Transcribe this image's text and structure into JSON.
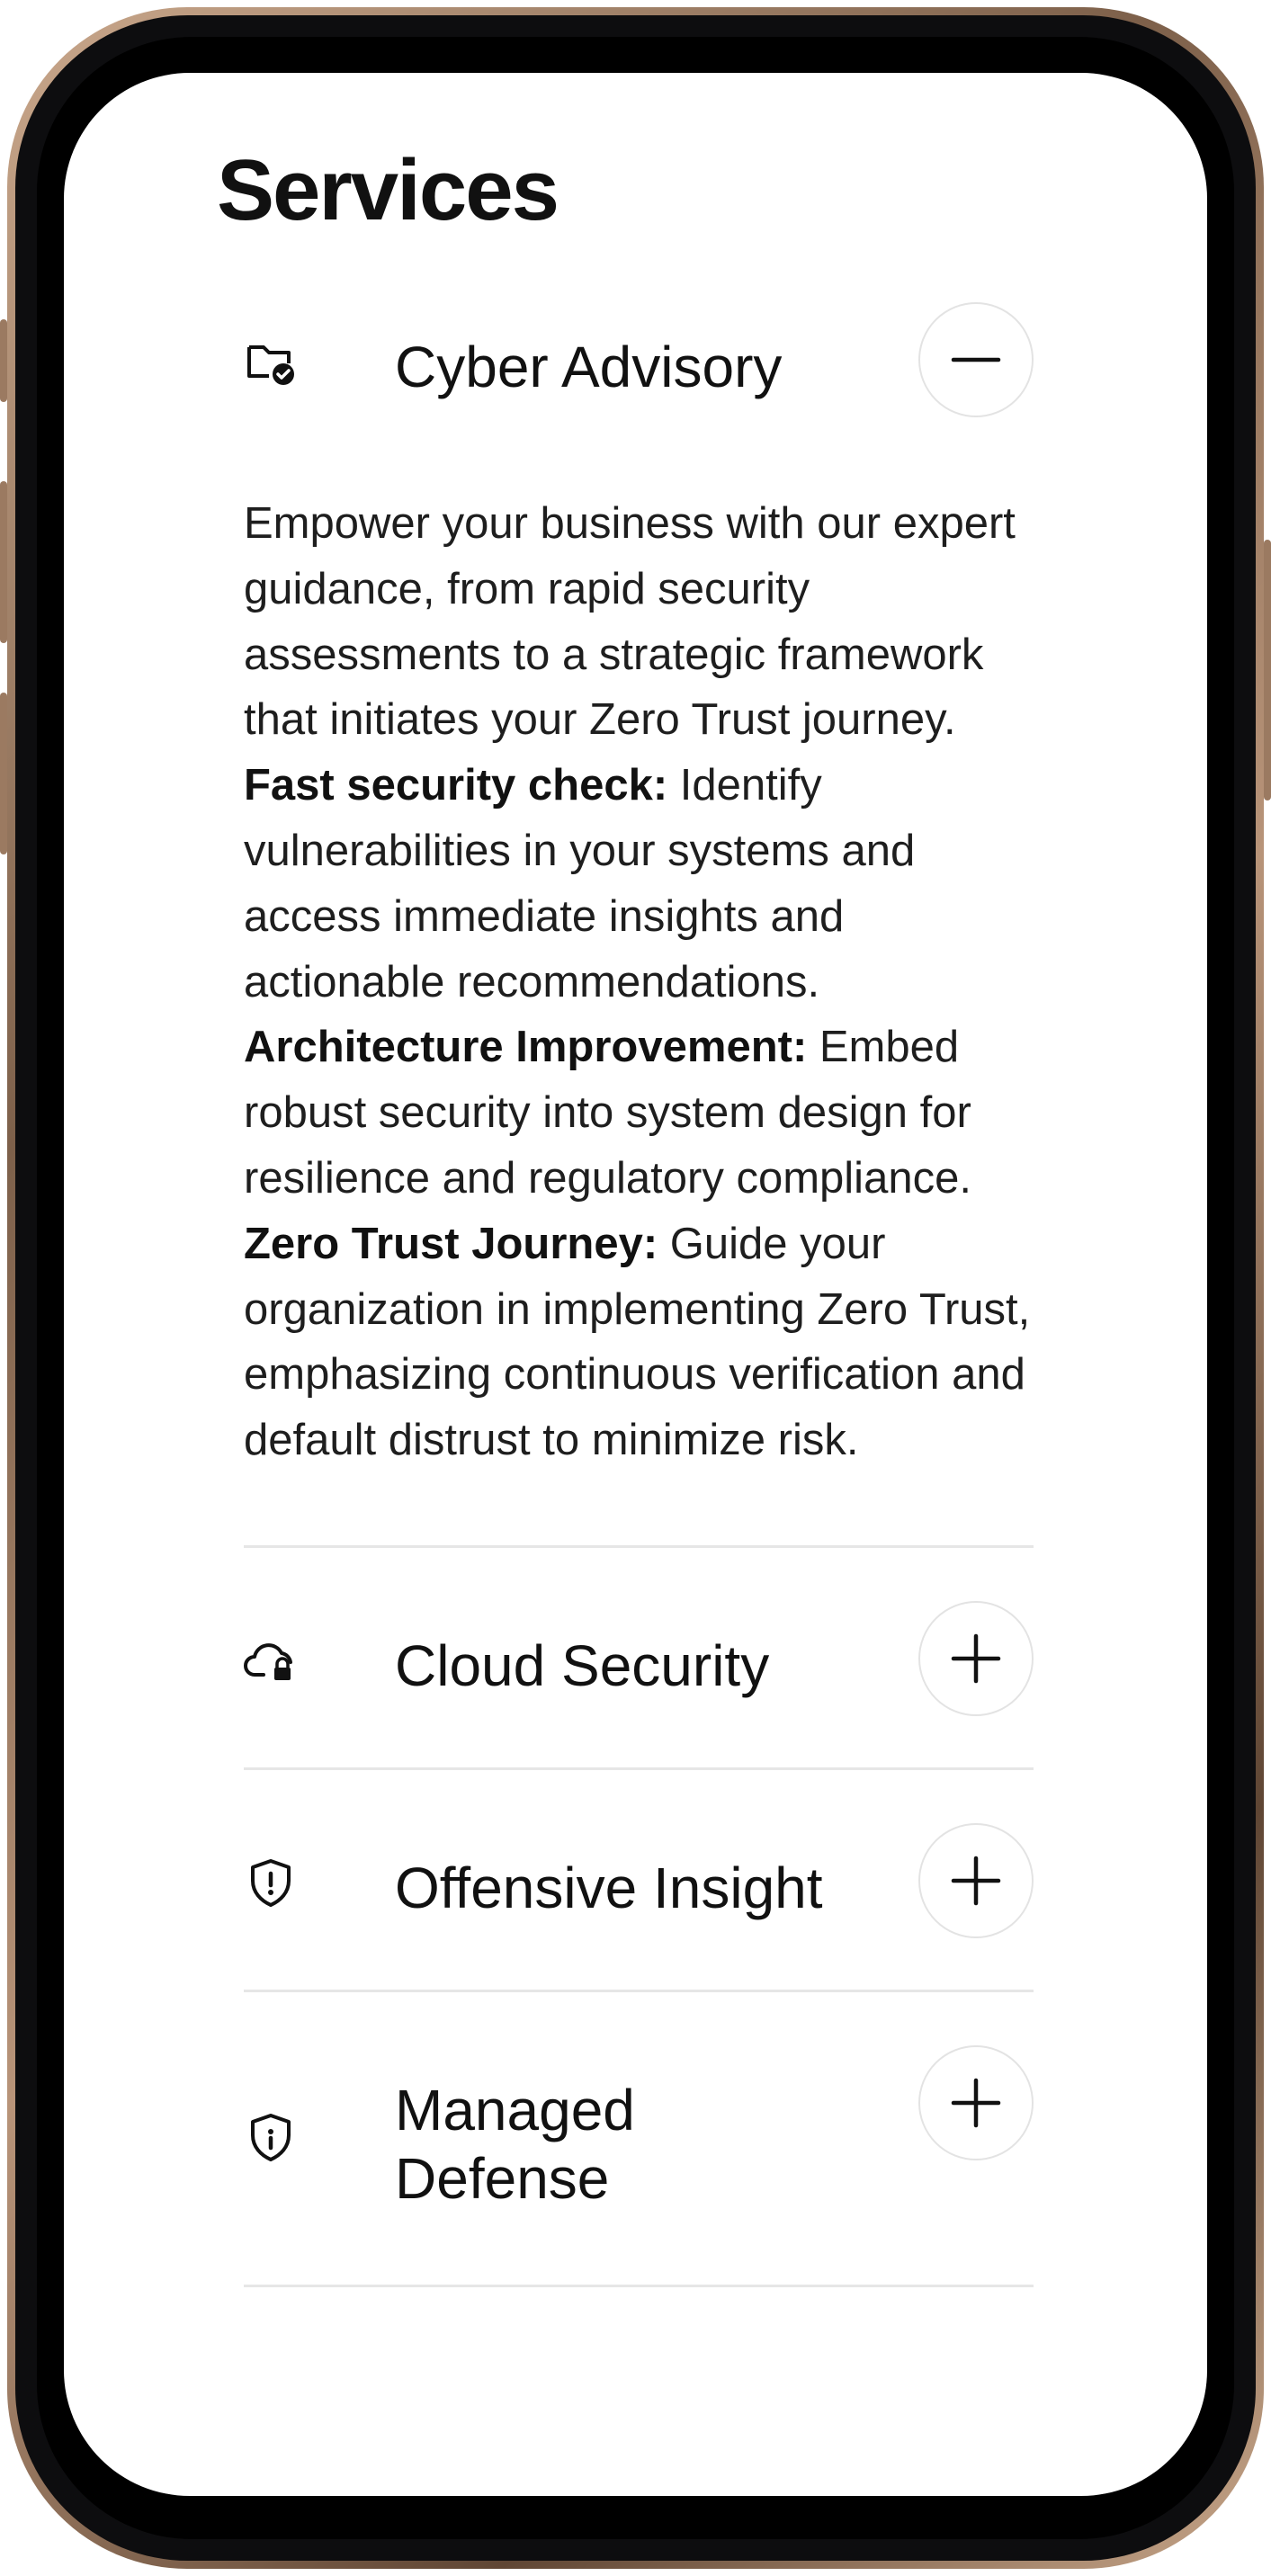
{
  "page": {
    "title": "Services"
  },
  "services": [
    {
      "title": "Cyber Advisory",
      "icon": "folder-check-icon",
      "expanded": true,
      "toggle_icon": "minus-icon",
      "intro": "Empower your business with our expert guidance, from rapid security assessments to a strategic framework that initiates your Zero Trust journey.",
      "points": [
        {
          "label": "Fast security check:",
          "text": " Identify vulnerabilities in your systems and access immediate insights and actionable recommendations."
        },
        {
          "label": "Architecture Improvement:",
          "text": " Embed robust security into system design for resilience and regulatory compliance."
        },
        {
          "label": "Zero Trust Journey:",
          "text": " Guide your organization in implementing Zero Trust, emphasizing continuous verification and default distrust to minimize risk."
        }
      ]
    },
    {
      "title": "Cloud Security",
      "icon": "cloud-lock-icon",
      "expanded": false,
      "toggle_icon": "plus-icon"
    },
    {
      "title": "Offensive Insight",
      "icon": "shield-alert-icon",
      "expanded": false,
      "toggle_icon": "plus-icon"
    },
    {
      "title": "Managed Defense",
      "icon": "shield-info-icon",
      "expanded": false,
      "toggle_icon": "plus-icon"
    }
  ],
  "colors": {
    "frame": "#b89479",
    "text": "#111111",
    "divider": "#e6e6e6",
    "toggle_border": "#e3e3e3"
  }
}
